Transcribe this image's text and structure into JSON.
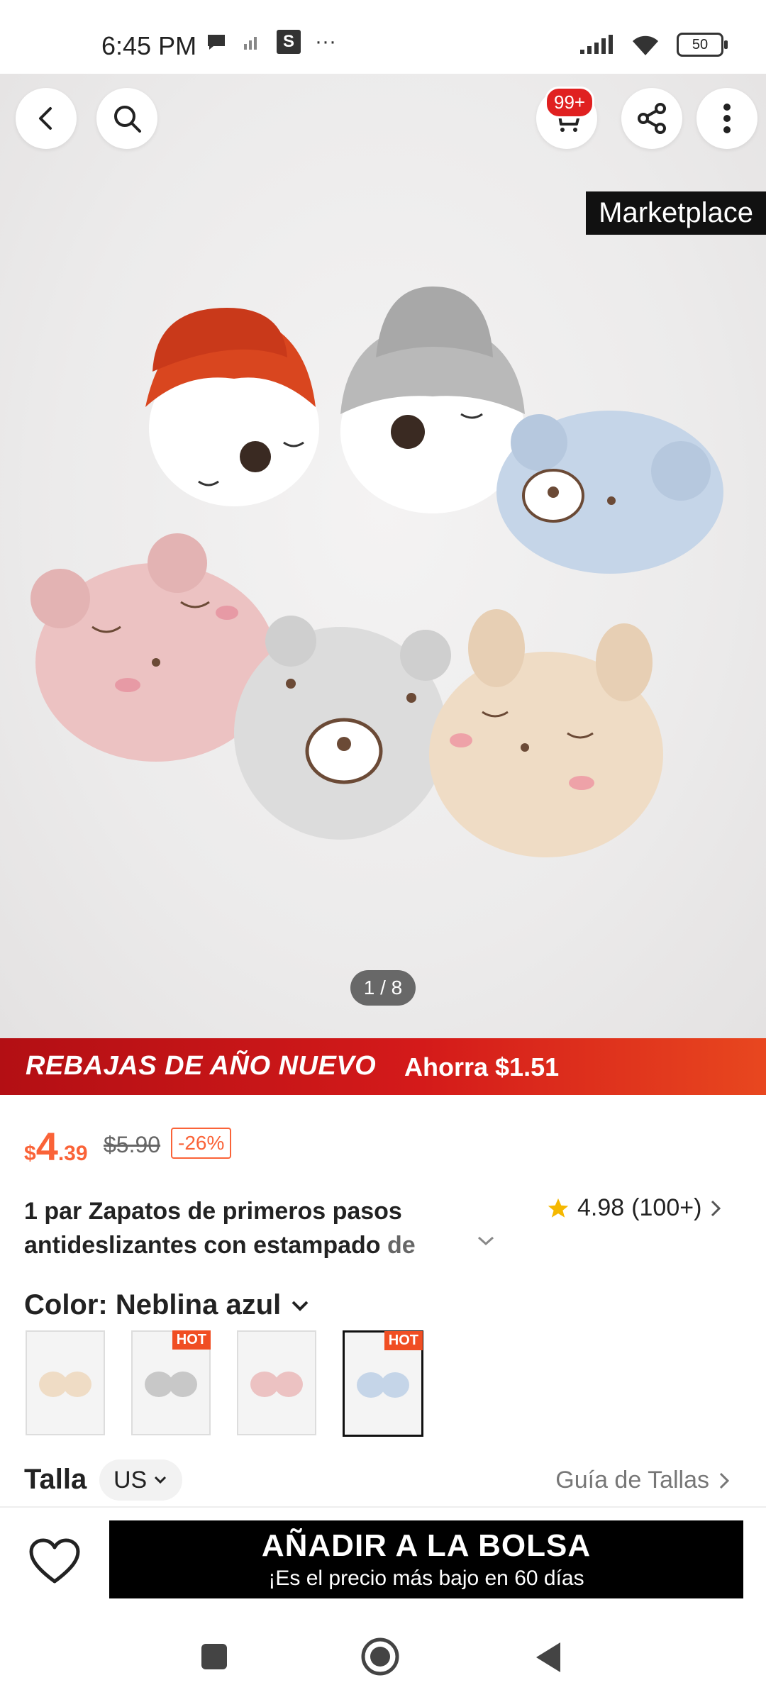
{
  "status_bar": {
    "time": "6:45 PM",
    "battery": "50",
    "extra_letter": "S",
    "dots": "···"
  },
  "hero": {
    "cart_badge": "99+",
    "marketplace_label": "Marketplace",
    "image_counter": "1 / 8"
  },
  "promo": {
    "left_text": "REBAJAS DE AÑO NUEVO",
    "right_text": "Ahorra $1.51"
  },
  "price": {
    "currency": "$",
    "integer": "4",
    "decimal": ".39",
    "original": "$5.90",
    "discount": "-26%"
  },
  "product": {
    "title_line1": "1 par Zapatos de primeros pasos",
    "title_line2": "antideslizantes con estampado ",
    "title_fade": "de",
    "rating": "4.98",
    "reviews": "(100+)"
  },
  "color": {
    "label": "Color: Neblina azul",
    "swatches": [
      {
        "name": "beige",
        "hot": ""
      },
      {
        "name": "gray",
        "hot": "HOT"
      },
      {
        "name": "pink",
        "hot": ""
      },
      {
        "name": "blue",
        "hot": "HOT"
      }
    ]
  },
  "size": {
    "label": "Talla",
    "unit": "US",
    "guide": "Guía de Tallas"
  },
  "cta": {
    "main": "AÑADIR A LA BOLSA",
    "sub": "¡Es el precio más bajo en 60 días"
  },
  "colors": {
    "accent": "#fa6338",
    "promo": "#d41a1a",
    "button": "#000000"
  }
}
